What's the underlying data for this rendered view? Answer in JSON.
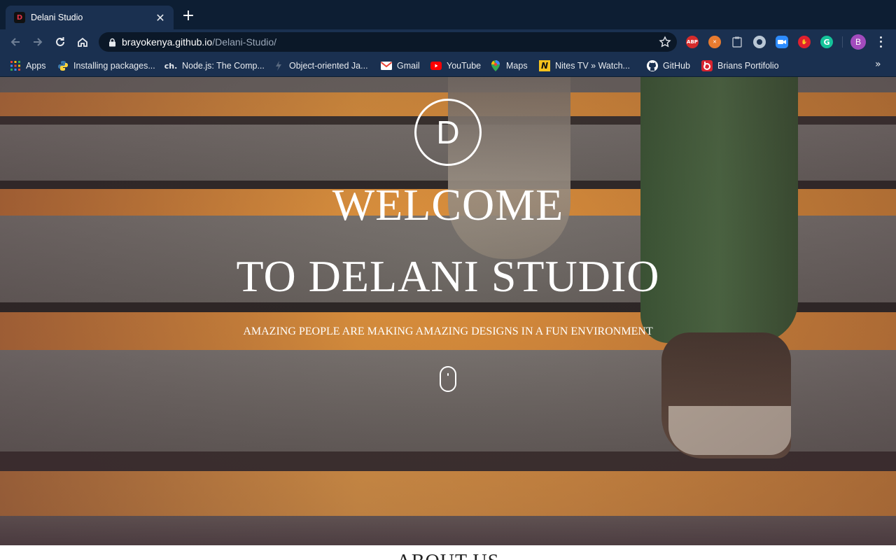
{
  "browser": {
    "tab_title": "Delani Studio",
    "tab_close": "✕",
    "new_tab": "+",
    "url_host": "brayokenya.github.io",
    "url_path": "/Delani-Studio/",
    "avatar_letter": "B",
    "extensions": [
      "ABP",
      "ublock-icon",
      "clipboard-icon",
      "circle-icon",
      "zoom-icon",
      "hand-icon",
      "grammarly-icon"
    ],
    "bookmarks": [
      {
        "label": "Apps",
        "icon": "apps-grid-icon"
      },
      {
        "label": "Installing packages...",
        "icon": "python-icon"
      },
      {
        "label": "Node.js: The Comp...",
        "icon": "ch-icon",
        "icon_text": "ch."
      },
      {
        "label": "Object-oriented Ja...",
        "icon": "bolt-icon"
      },
      {
        "label": "Gmail",
        "icon": "gmail-icon"
      },
      {
        "label": "YouTube",
        "icon": "youtube-icon"
      },
      {
        "label": "Maps",
        "icon": "maps-icon"
      },
      {
        "label": "Nites TV » Watch...",
        "icon": "nitestv-icon",
        "icon_text": "N"
      },
      {
        "label": "GitHub",
        "icon": "github-icon"
      },
      {
        "label": "Brians Portifolio",
        "icon": "portfolio-icon"
      }
    ],
    "more_bookmarks": "»"
  },
  "hero": {
    "logo_letter": "D",
    "title_line1": "WELCOME",
    "title_line2": "TO DELANI STUDIO",
    "subtitle": "AMAZING PEOPLE ARE MAKING AMAZING DESIGNS IN A FUN ENVIRONMENT"
  },
  "about": {
    "title": "ABOUT US"
  }
}
